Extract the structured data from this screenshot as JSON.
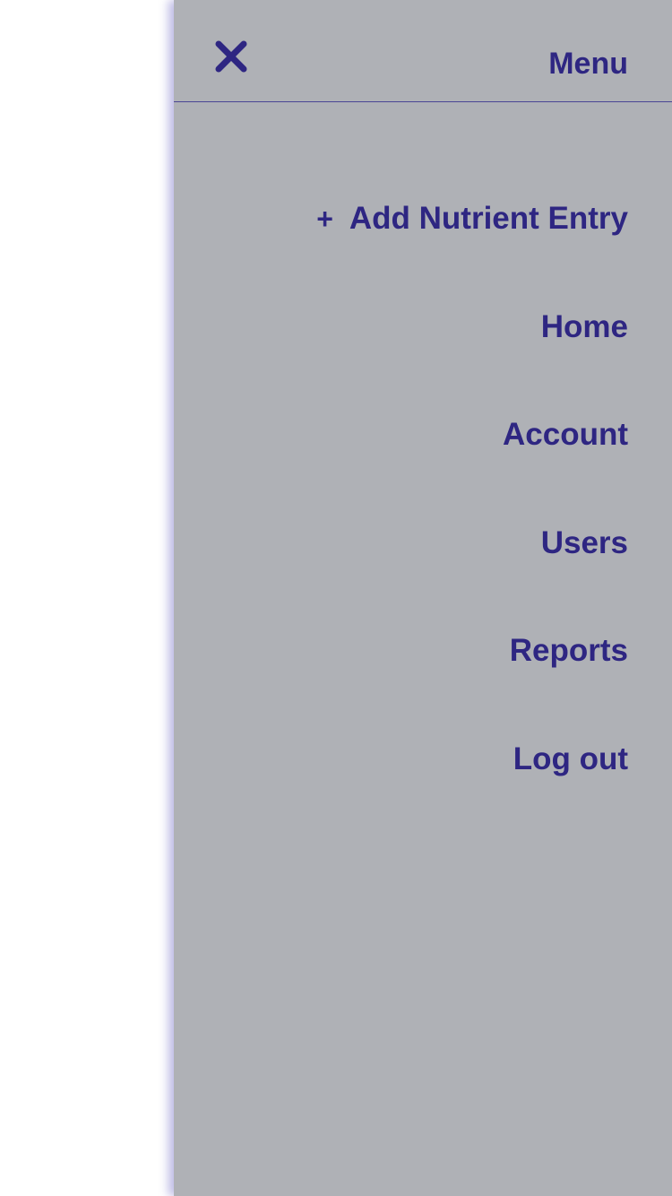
{
  "colors": {
    "drawer_background": "#afb1b6",
    "accent": "#2e2682",
    "page_background": "#ffffff"
  },
  "header": {
    "title": "Menu",
    "close_icon": "close-icon"
  },
  "menu": {
    "add_icon": "+",
    "items": [
      {
        "label": "Add Nutrient Entry"
      },
      {
        "label": "Home"
      },
      {
        "label": "Account"
      },
      {
        "label": "Users"
      },
      {
        "label": "Reports"
      },
      {
        "label": "Log out"
      }
    ]
  }
}
